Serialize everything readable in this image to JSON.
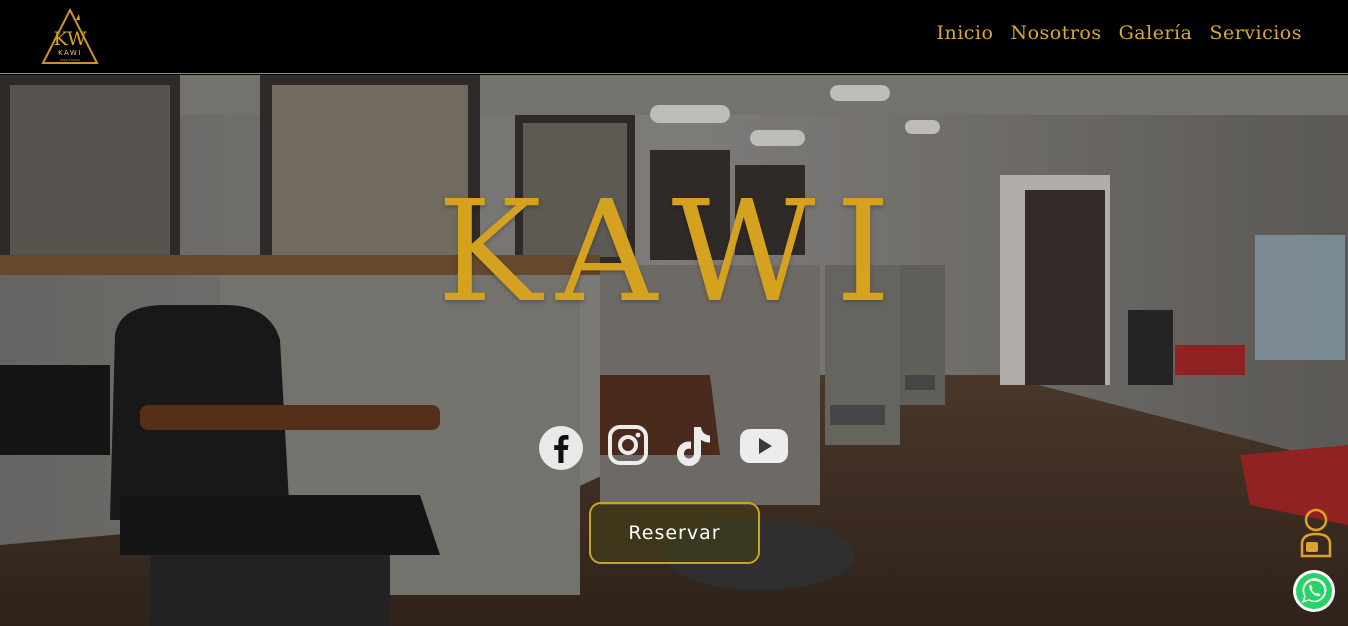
{
  "brand": {
    "logo_text": "KW",
    "logo_subtext": "KAWI",
    "logo_tagline": "HAIR STUDIO",
    "color_gold": "#d5a21f"
  },
  "nav": {
    "items": [
      {
        "label": "Inicio"
      },
      {
        "label": "Nosotros"
      },
      {
        "label": "Galería"
      },
      {
        "label": "Servicios"
      }
    ]
  },
  "hero": {
    "title": "KAWI",
    "background": "barbershop-interior-photo",
    "reserve_label": "Reservar"
  },
  "socials": [
    {
      "icon": "facebook-icon"
    },
    {
      "icon": "instagram-icon"
    },
    {
      "icon": "tiktok-icon"
    },
    {
      "icon": "youtube-icon"
    }
  ],
  "floating": {
    "assistant_icon": "assistant-icon",
    "whatsapp_icon": "whatsapp-icon",
    "whatsapp_color": "#25d366"
  }
}
